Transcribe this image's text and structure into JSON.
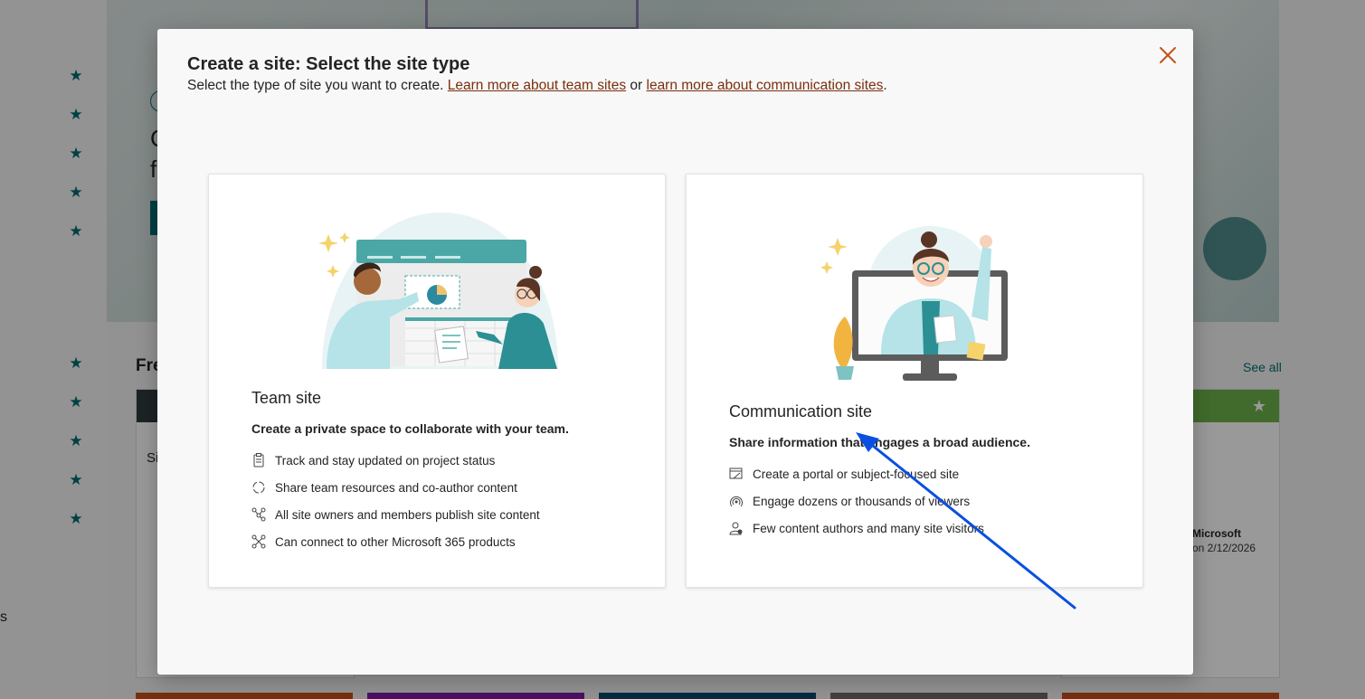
{
  "background": {
    "rail_text": "s",
    "hero_title_lines": [
      "C",
      "f"
    ],
    "section_title": "Fre",
    "see_all": "See all",
    "card_initial": "Si",
    "card_meta_author": "Microsoft",
    "card_meta_date": "on 2/12/2026",
    "colors": {
      "accent": "#036c70",
      "stripe_colors": [
        "#c4501a",
        "#7b1fa2",
        "#0b4a6f",
        "#6b6b6b",
        "#c4501a"
      ]
    }
  },
  "dialog": {
    "title": "Create a site: Select the site type",
    "subtitle_prefix": "Select the type of site you want to create. ",
    "link_team": "Learn more about team sites",
    "subtitle_or": " or ",
    "link_comm": "learn more about communication sites",
    "subtitle_end": ".",
    "close_icon": "close-icon",
    "cards": [
      {
        "title": "Team site",
        "description": "Create a private space to collaborate with your team.",
        "features": [
          {
            "icon": "clipboard-icon",
            "text": "Track and stay updated on project status"
          },
          {
            "icon": "sync-icon",
            "text": "Share team resources and co-author content"
          },
          {
            "icon": "people-network-icon",
            "text": "All site owners and members publish site content"
          },
          {
            "icon": "connector-icon",
            "text": "Can connect to other Microsoft 365 products"
          }
        ]
      },
      {
        "title": "Communication site",
        "description": "Share information that engages a broad audience.",
        "features": [
          {
            "icon": "page-edit-icon",
            "text": "Create a portal or subject-focused site"
          },
          {
            "icon": "broadcast-icon",
            "text": "Engage dozens or thousands of viewers"
          },
          {
            "icon": "person-icon",
            "text": "Few content authors and many site visitors"
          }
        ]
      }
    ]
  },
  "annotation": {
    "arrow_color": "#0a4fe0"
  }
}
